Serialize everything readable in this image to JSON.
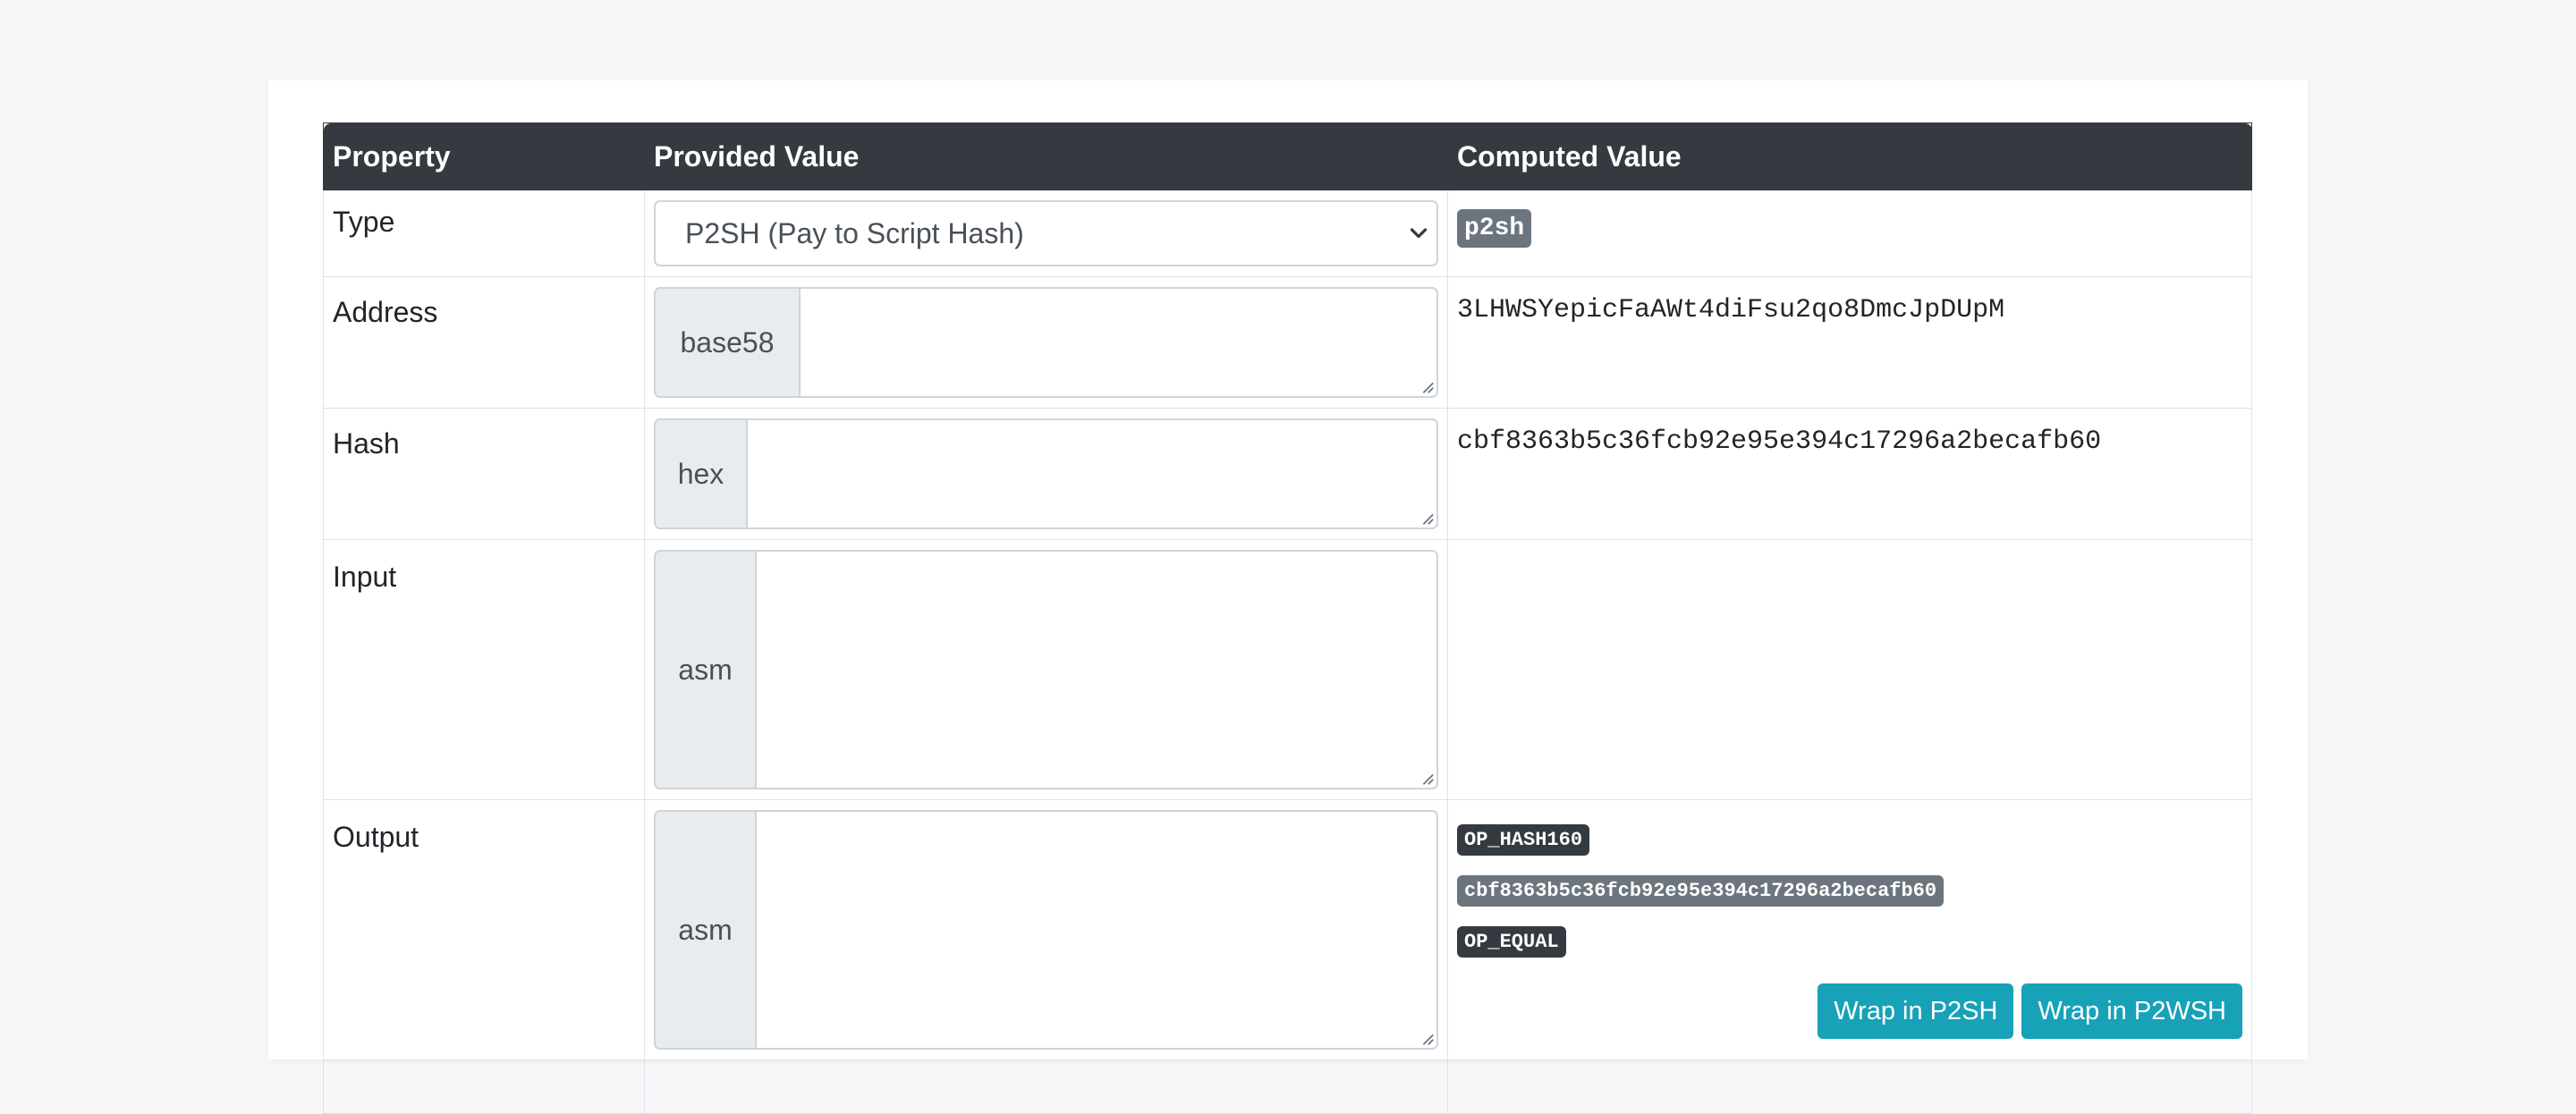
{
  "table": {
    "headers": [
      "Property",
      "Provided Value",
      "Computed Value"
    ]
  },
  "rows": {
    "type": {
      "label": "Type",
      "select_value": "P2SH (Pay to Script Hash)",
      "computed_badge": "p2sh"
    },
    "address": {
      "label": "Address",
      "addon": "base58",
      "value": "",
      "computed": "3LHWSYepicFaAWt4diFsu2qo8DmcJpDUpM"
    },
    "hash": {
      "label": "Hash",
      "addon": "hex",
      "value": "",
      "computed": "cbf8363b5c36fcb92e95e394c17296a2becafb60"
    },
    "input": {
      "label": "Input",
      "addon": "asm",
      "value": ""
    },
    "output": {
      "label": "Output",
      "addon": "asm",
      "value": "",
      "ops": [
        "OP_HASH160",
        "cbf8363b5c36fcb92e95e394c17296a2becafb60",
        "OP_EQUAL"
      ],
      "wrap_p2sh": "Wrap in P2SH",
      "wrap_p2wsh": "Wrap in P2WSH"
    }
  },
  "colors": {
    "header_bg": "#343a40",
    "badge_gray": "#6c757d",
    "button_info": "#17a2b8",
    "addon_bg": "#e9ecef"
  },
  "icons": {
    "select": "chevron-down-icon",
    "textarea": "resize-handle-icon"
  }
}
